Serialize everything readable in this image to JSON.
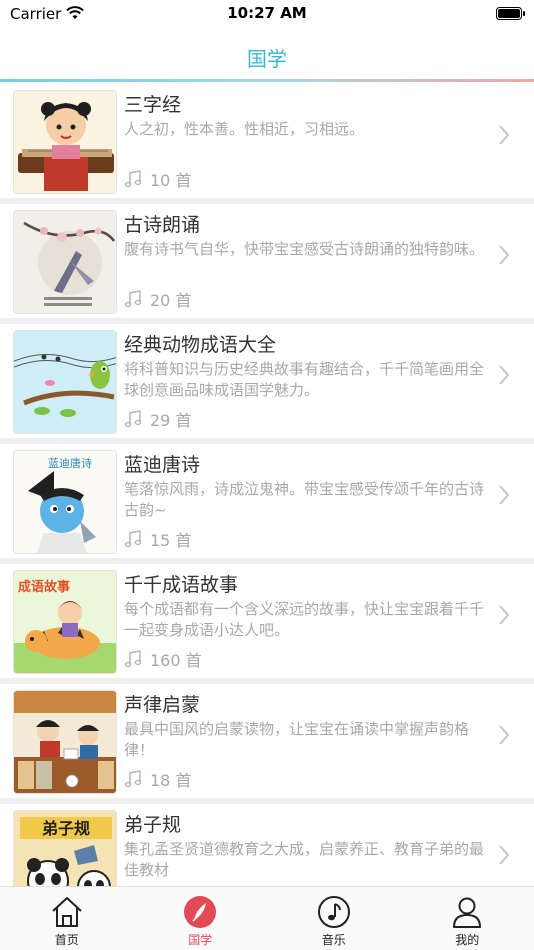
{
  "status_bar": {
    "carrier": "Carrier",
    "time": "10:27 AM"
  },
  "nav": {
    "title": "国学"
  },
  "items": [
    {
      "title": "三字经",
      "desc": "人之初，性本善。性相近，习相远。",
      "count": "10 首"
    },
    {
      "title": "古诗朗诵",
      "desc": "腹有诗书气自华，快带宝宝感受古诗朗诵的独特韵味。",
      "count": "20 首"
    },
    {
      "title": "经典动物成语大全",
      "desc": "将科普知识与历史经典故事有趣结合，千千简笔画用全球创意画品味成语国学魅力。",
      "count": "29 首"
    },
    {
      "title": "蓝迪唐诗",
      "desc": "笔落惊风雨，诗成泣鬼神。带宝宝感受传颂千年的古诗古韵~",
      "count": "15 首",
      "thumb_text": "蓝迪唐诗"
    },
    {
      "title": "千千成语故事",
      "desc": "每个成语都有一个含义深远的故事，快让宝宝跟着千千一起变身成语小达人吧。",
      "count": "160 首",
      "thumb_text": "成语故事"
    },
    {
      "title": "声律启蒙",
      "desc": "最具中国风的启蒙读物，让宝宝在诵读中掌握声韵格律！",
      "count": "18 首"
    },
    {
      "title": "弟子规",
      "desc": "集孔孟圣贤道德教育之大成，启蒙养正、教育子弟的最佳教材",
      "count": "",
      "thumb_text": "弟子规"
    }
  ],
  "tabs": [
    {
      "label": "首页",
      "icon": "home-icon"
    },
    {
      "label": "国学",
      "icon": "brush-icon"
    },
    {
      "label": "音乐",
      "icon": "music-note-icon"
    },
    {
      "label": "我的",
      "icon": "person-icon"
    }
  ],
  "colors": {
    "accent": "#38b6d8",
    "tab_active": "#e24b56",
    "text_muted": "#a8a8a8"
  }
}
